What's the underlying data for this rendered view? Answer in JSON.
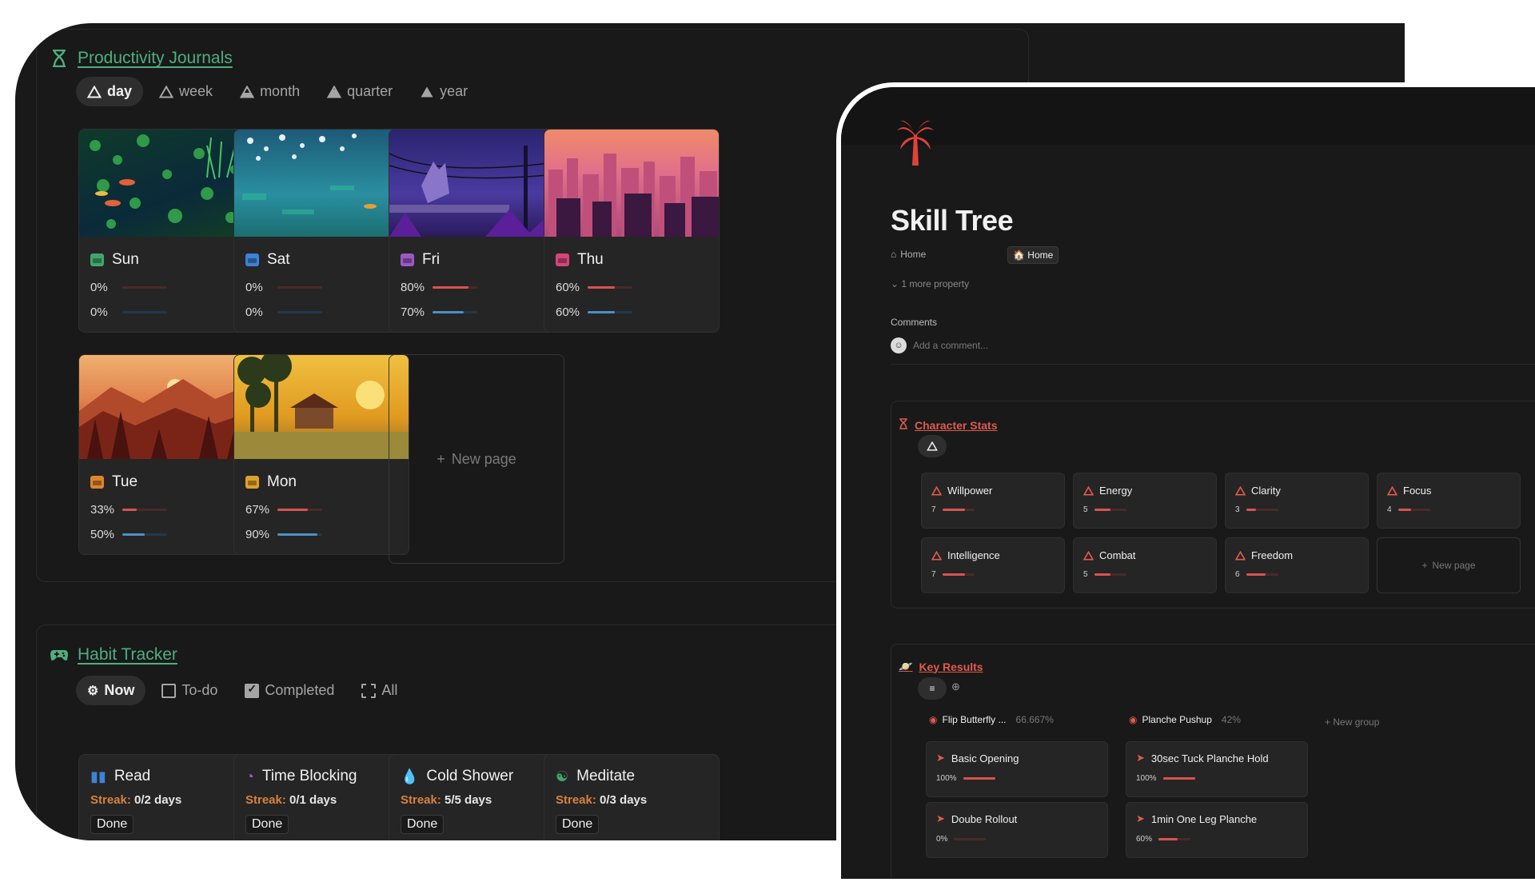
{
  "journals": {
    "title": "Productivity Journals",
    "tabs": [
      "day",
      "week",
      "month",
      "quarter",
      "year"
    ],
    "cards": [
      {
        "day": "Sun",
        "icon_color": "#3fa66b",
        "p1": "0%",
        "p1_value": 0,
        "p2": "0%",
        "p2_value": 0
      },
      {
        "day": "Sat",
        "icon_color": "#3d82d6",
        "p1": "0%",
        "p1_value": 0,
        "p2": "0%",
        "p2_value": 0
      },
      {
        "day": "Fri",
        "icon_color": "#9b59c6",
        "p1": "80%",
        "p1_value": 80,
        "p2": "70%",
        "p2_value": 70
      },
      {
        "day": "Thu",
        "icon_color": "#d6457a",
        "p1": "60%",
        "p1_value": 60,
        "p2": "60%",
        "p2_value": 60
      },
      {
        "day": "Tue",
        "icon_color": "#e0842c",
        "p1": "33%",
        "p1_value": 33,
        "p2": "50%",
        "p2_value": 50
      },
      {
        "day": "Mon",
        "icon_color": "#e0a02c",
        "p1": "67%",
        "p1_value": 67,
        "p2": "90%",
        "p2_value": 90
      }
    ],
    "new_page": "New page"
  },
  "habits": {
    "title": "Habit Tracker",
    "tabs": [
      "Now",
      "To-do",
      "Completed",
      "All"
    ],
    "streak_label": "Streak:",
    "done_label": "Done",
    "cards": [
      {
        "name": "Read",
        "streak": "0/2 days",
        "icon": "book-icon"
      },
      {
        "name": "Time Blocking",
        "streak": "0/1 days",
        "icon": "clock-icon"
      },
      {
        "name": "Cold Shower",
        "streak": "5/5 days",
        "icon": "drop-icon"
      },
      {
        "name": "Meditate",
        "streak": "0/3 days",
        "icon": "yin-yang-icon"
      }
    ]
  },
  "skill": {
    "title": "Skill Tree",
    "property_name": "Home",
    "property_value": "Home",
    "more_property": "1 more property",
    "comments_label": "Comments",
    "comment_placeholder": "Add a comment...",
    "stats_title": "Character Stats",
    "stats": [
      {
        "name": "Willpower",
        "value": "7"
      },
      {
        "name": "Energy",
        "value": "5"
      },
      {
        "name": "Clarity",
        "value": "3"
      },
      {
        "name": "Focus",
        "value": "4"
      },
      {
        "name": "Intelligence",
        "value": "7"
      },
      {
        "name": "Combat",
        "value": "5"
      },
      {
        "name": "Freedom",
        "value": "6"
      }
    ],
    "new_page": "New page",
    "kr_title": "Key Results",
    "groups": [
      {
        "name": "Flip Butterfly ...",
        "pct": "66.667%",
        "items": [
          {
            "name": "Basic Opening",
            "value": "100%",
            "v": 100
          },
          {
            "name": "Doube Rollout",
            "value": "0%",
            "v": 0
          }
        ]
      },
      {
        "name": "Planche Pushup",
        "pct": "42%",
        "items": [
          {
            "name": "30sec Tuck Planche Hold",
            "value": "100%",
            "v": 100
          },
          {
            "name": "1min One Leg Planche",
            "value": "60%",
            "v": 60
          }
        ]
      }
    ],
    "new_group": "New group"
  },
  "colors": {
    "accent_green": "#4fae7e",
    "accent_red": "#e05a4f",
    "streak_orange": "#d9813f"
  }
}
